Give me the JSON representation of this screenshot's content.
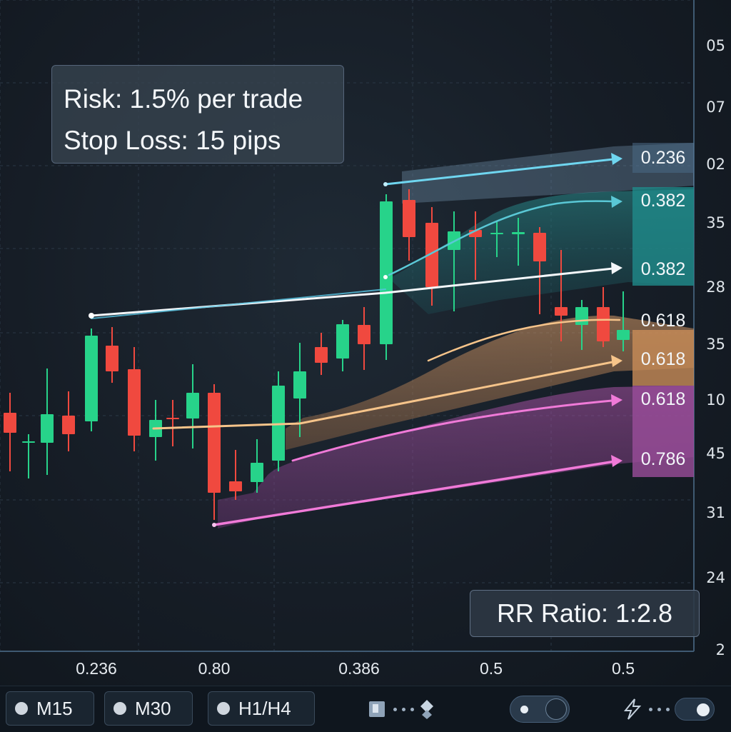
{
  "chart_data": {
    "type": "candlestick",
    "info": {
      "risk": "Risk: 1.5% per trade",
      "stop_loss": "Stop Loss: 15 pips"
    },
    "rr_ratio": "RR Ratio: 1:2.8",
    "y_tick_labels": [
      "05",
      "07",
      "02",
      "35",
      "28",
      "35",
      "10",
      "45",
      "31",
      "24",
      "2"
    ],
    "x_tick_labels": [
      "0.236",
      "0.80",
      "0.386",
      "0.5",
      "0.5"
    ],
    "fib_labels": [
      "0.236",
      "0.382",
      "0.382",
      "0.618",
      "0.618",
      "0.618",
      "0.786"
    ],
    "colors": {
      "bull": "#27d38a",
      "bear": "#f0493f",
      "cyan": "#5fd3ea",
      "orange": "#f6c48a",
      "pink": "#f07ad8",
      "teal": "#2fa7a0"
    }
  },
  "toolbar": {
    "timeframes": [
      "M15",
      "M30",
      "H1/H4"
    ],
    "icons": [
      "flag-icon",
      "dots-icon",
      "diamond-icon",
      "toggle-switch",
      "lightning-icon",
      "dots-icon",
      "toggle-pill"
    ]
  }
}
